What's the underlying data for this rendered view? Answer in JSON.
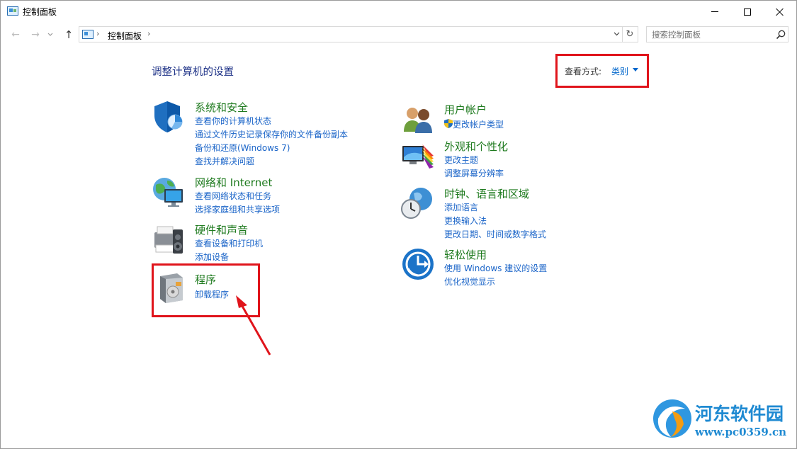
{
  "window": {
    "title": "控制面板"
  },
  "nav": {
    "back": "←",
    "forward": "→",
    "recent": "⌄",
    "up": "↑",
    "sep": "›",
    "breadcrumb": "控制面板",
    "dropdown": "⌄",
    "refresh": "↻"
  },
  "search": {
    "placeholder": "搜索控制面板"
  },
  "main": {
    "heading": "调整计算机的设置",
    "view_by": {
      "label": "查看方式:",
      "value": "类别"
    }
  },
  "categories": {
    "system_security": {
      "title": "系统和安全",
      "links": [
        "查看你的计算机状态",
        "通过文件历史记录保存你的文件备份副本",
        "备份和还原(Windows 7)",
        "查找并解决问题"
      ]
    },
    "network": {
      "title": "网络和 Internet",
      "links": [
        "查看网络状态和任务",
        "选择家庭组和共享选项"
      ]
    },
    "hardware": {
      "title": "硬件和声音",
      "links": [
        "查看设备和打印机",
        "添加设备"
      ]
    },
    "programs": {
      "title": "程序",
      "links": [
        "卸载程序"
      ]
    },
    "user_accounts": {
      "title": "用户帐户",
      "links": [
        "更改帐户类型"
      ]
    },
    "appearance": {
      "title": "外观和个性化",
      "links": [
        "更改主题",
        "调整屏幕分辨率"
      ]
    },
    "clock_region": {
      "title": "时钟、语言和区域",
      "links": [
        "添加语言",
        "更换输入法",
        "更改日期、时间或数字格式"
      ]
    },
    "ease_of_access": {
      "title": "轻松使用",
      "links": [
        "使用 Windows 建议的设置",
        "优化视觉显示"
      ]
    }
  },
  "watermark": {
    "name": "河东软件园",
    "url": "www.pc0359.cn"
  },
  "colors": {
    "category_title": "#1e7a1e",
    "link": "#1a64c8",
    "heading": "#1e3287",
    "highlight": "#e0141b"
  }
}
